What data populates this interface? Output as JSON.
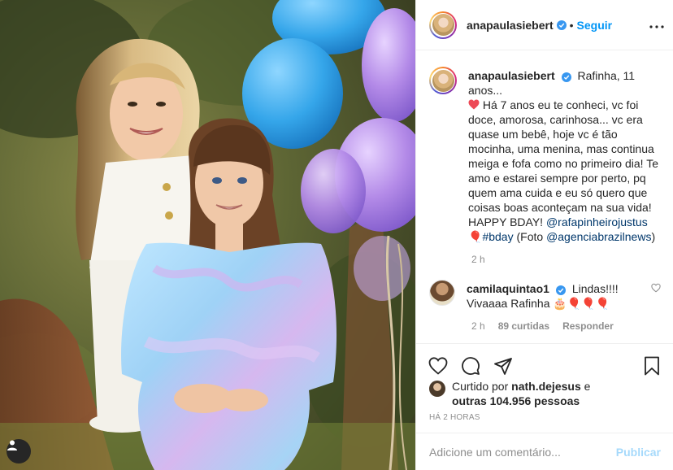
{
  "post": {
    "username": "anapaulasiebert",
    "follow_label": "Seguir",
    "separator": "•",
    "caption": {
      "username": "anapaulasiebert",
      "first_line": "Rafinha, 11 anos...",
      "body": "Há 7 anos eu te conheci, vc foi doce, amorosa, carinhosa... vc era quase um bebê, hoje vc é tão mocinha, uma menina, mas continua meiga e fofa como no primeiro dia! Te amo e estarei sempre por perto, pq quem ama cuida e eu só quero que coisas boas aconteçam na sua vida! HAPPY BDAY!",
      "mention_1": "@rafapinheirojustus",
      "balloon_emoji": "🎈",
      "hashtag": "#bday",
      "foto_label": "(Foto",
      "mention_2": "@agenciabrazilnews",
      "close_paren": ")",
      "time": "2 h"
    },
    "comment": {
      "username": "camilaquintao1",
      "text_1": "Lindas!!!!",
      "text_2": "Vivaaaa Rafinha",
      "emojis": "🎂🎈🎈🎈",
      "time": "2 h",
      "likes": "89 curtidas",
      "reply": "Responder"
    },
    "likes": {
      "prefix": "Curtido por",
      "user": "nath.dejesus",
      "conjunction": "e",
      "others": "outras 104.956 pessoas"
    },
    "timestamp": "HÁ 2 HORAS",
    "comment_input": {
      "placeholder": "Adicione um comentário...",
      "publish_label": "Publicar"
    }
  },
  "icons": {
    "heart": "heart-outline-icon",
    "comment": "comment-icon",
    "share": "paper-plane-icon",
    "bookmark": "bookmark-icon",
    "more": "more-options-icon",
    "verified": "verified-badge-icon",
    "user_tag": "user-tag-icon"
  },
  "colors": {
    "link": "#0095f6",
    "mention": "#00376b",
    "verified": "#3897f0",
    "heart_red": "#ed4956",
    "meta_gray": "#8e8e8e"
  }
}
